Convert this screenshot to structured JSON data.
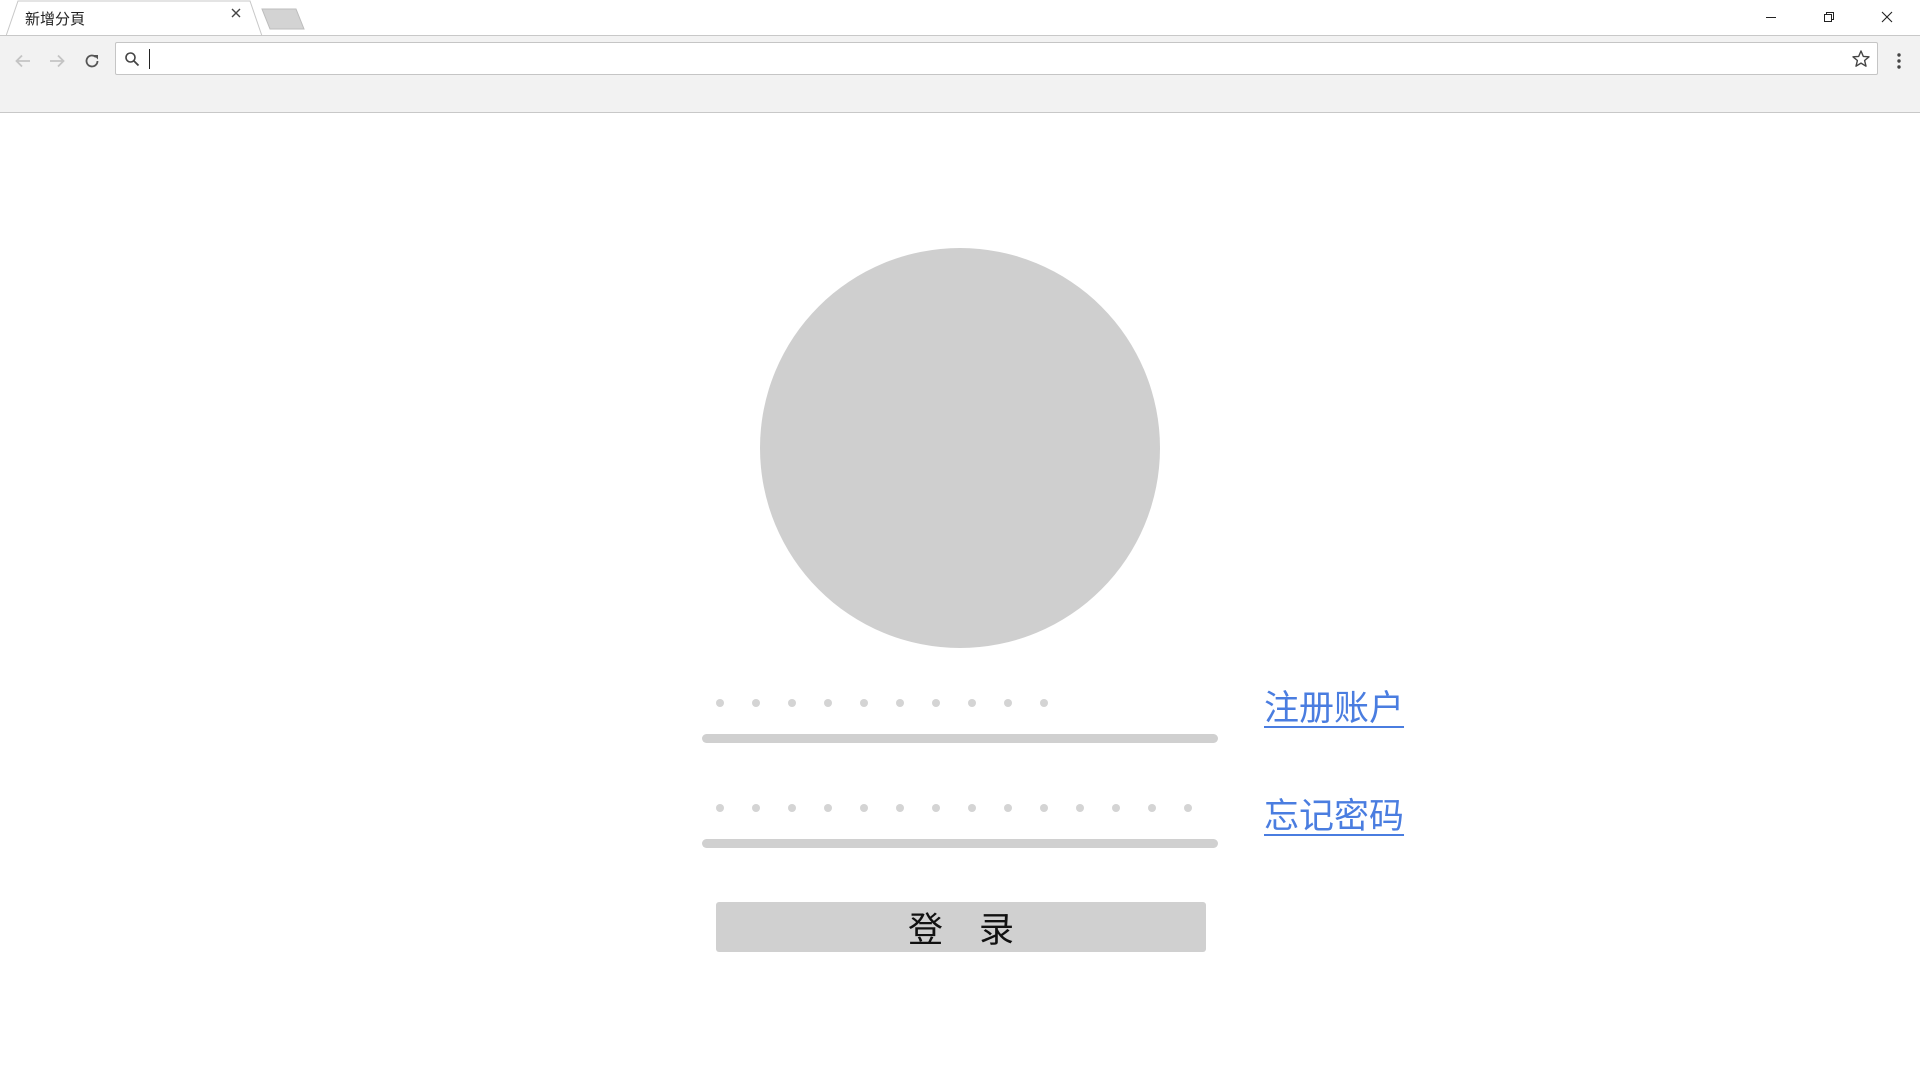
{
  "browser": {
    "tab_title": "新增分頁",
    "omnibox_value": "",
    "icons": {
      "tab_close": "close-icon",
      "back": "arrow-left-icon",
      "forward": "arrow-right-icon",
      "reload": "reload-icon",
      "search": "search-icon",
      "bookmark": "star-icon",
      "menu": "more-vert-icon",
      "minimize": "minimize-icon",
      "maximize": "restore-icon",
      "close": "close-icon"
    }
  },
  "login": {
    "avatar_color": "#cfcfcf",
    "username_masked_chars": 10,
    "password_masked_chars": 14,
    "register_link": "注册账户",
    "forgot_link": "忘记密码",
    "login_button": "登录",
    "link_color": "#4a7de0"
  }
}
